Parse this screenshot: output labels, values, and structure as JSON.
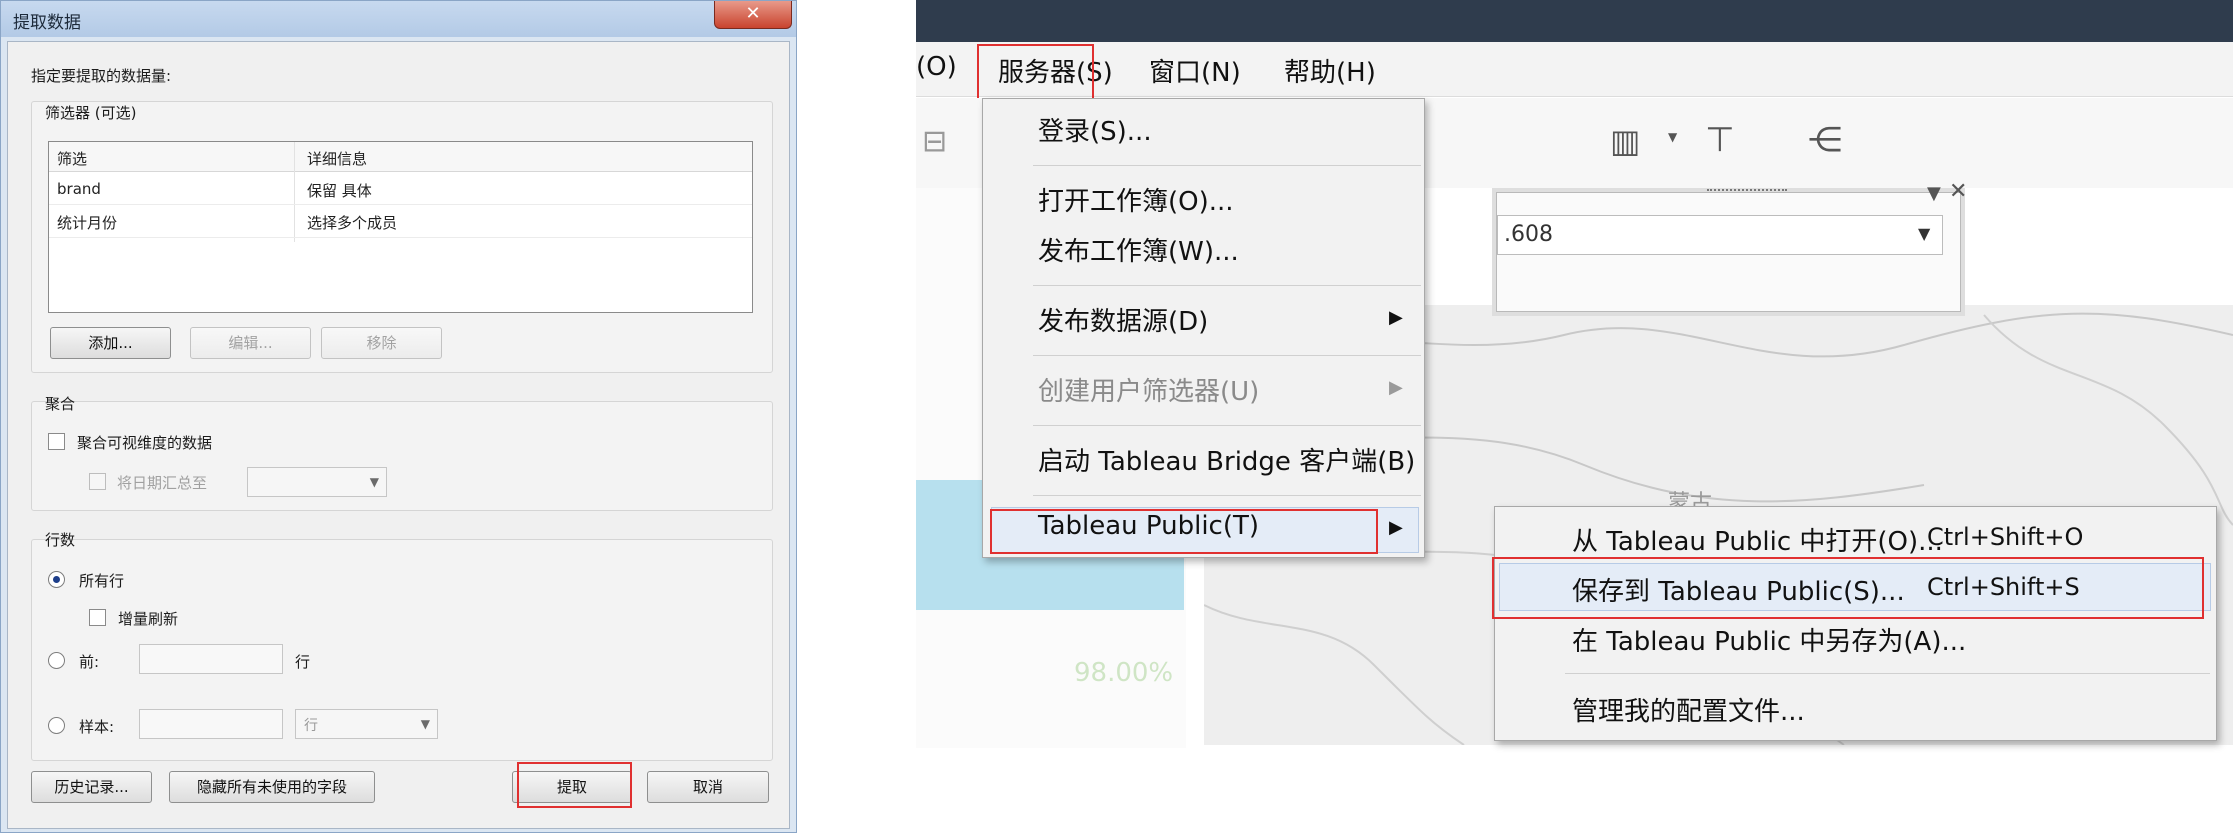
{
  "dialog": {
    "title": "提取数据",
    "close_glyph": "✕",
    "prompt": "指定要提取的数据量:",
    "filters": {
      "group_title": "筛选器 (可选)",
      "columns": [
        "筛选",
        "详细信息"
      ],
      "rows": [
        {
          "filter": "brand",
          "detail": "保留 具体"
        },
        {
          "filter": "统计月份",
          "detail": "选择多个成员"
        }
      ],
      "add_label": "添加...",
      "edit_label": "编辑...",
      "remove_label": "移除"
    },
    "aggregation": {
      "group_title": "聚合",
      "aggregate_label": "聚合可视维度的数据",
      "rollup_label": "将日期汇总至"
    },
    "rows_section": {
      "group_title": "行数",
      "all_rows_label": "所有行",
      "incremental_label": "增量刷新",
      "top_label": "前:",
      "top_unit": "行",
      "sample_label": "样本:",
      "sample_unit": "行"
    },
    "history_label": "历史记录...",
    "hide_fields_label": "隐藏所有未使用的字段",
    "extract_label": "提取",
    "cancel_label": "取消"
  },
  "tableau": {
    "menubar": [
      "(O)",
      "服务器(S)",
      "窗口(N)",
      "帮助(H)"
    ],
    "filter_value": ".608",
    "percent_text": "98.00%",
    "map_label": "蒙古",
    "server_menu": {
      "login": "登录(S)...",
      "open_workbook": "打开工作簿(O)...",
      "publish_workbook": "发布工作簿(W)...",
      "publish_datasource": "发布数据源(D)",
      "create_user_filter": "创建用户筛选器(U)",
      "start_bridge": "启动 Tableau Bridge 客户端(B)",
      "tableau_public": "Tableau Public(T)"
    },
    "public_submenu": [
      {
        "label": "从 Tableau Public 中打开(O)...",
        "shortcut": "Ctrl+Shift+O"
      },
      {
        "label": "保存到 Tableau Public(S)...",
        "shortcut": "Ctrl+Shift+S"
      },
      {
        "label": "在 Tableau Public 中另存为(A)...",
        "shortcut": ""
      },
      {
        "label": "管理我的配置文件...",
        "shortcut": ""
      }
    ],
    "colors": {
      "highlight_box": "#e03030",
      "menu_bg": "#f2f2f2",
      "title_bar": "#2f3c4d"
    }
  }
}
